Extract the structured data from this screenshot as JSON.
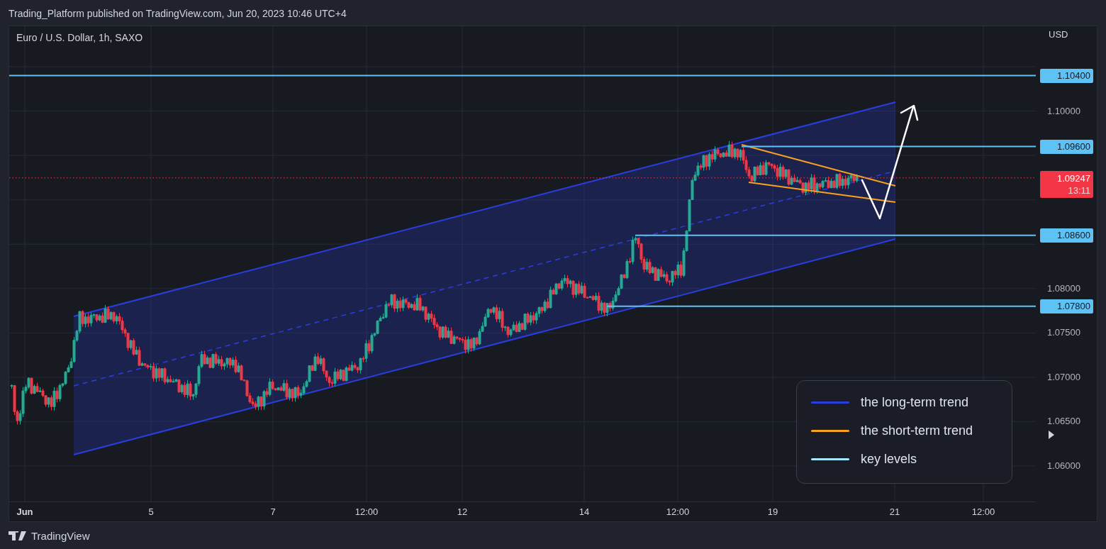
{
  "header": {
    "title": "Trading_Platform published on TradingView.com, Jun 20, 2023 10:46 UTC+4"
  },
  "chart": {
    "symbol": "Euro / U.S. Dollar, 1h, SAXO",
    "currency": "USD",
    "y_ticks": [
      "1.10000",
      "1.08000",
      "1.07500",
      "1.07000",
      "1.06500",
      "1.06000"
    ],
    "x_ticks": [
      {
        "label": "Jun",
        "kind": "month"
      },
      {
        "label": "5",
        "kind": "day"
      },
      {
        "label": "7",
        "kind": "day"
      },
      {
        "label": "12:00",
        "kind": "time"
      },
      {
        "label": "12",
        "kind": "day"
      },
      {
        "label": "14",
        "kind": "day"
      },
      {
        "label": "12:00",
        "kind": "time"
      },
      {
        "label": "19",
        "kind": "day"
      },
      {
        "label": "21",
        "kind": "day"
      },
      {
        "label": "12:00",
        "kind": "time"
      }
    ],
    "key_levels": [
      "1.10400",
      "1.09600",
      "1.08600",
      "1.07800"
    ],
    "last_price": {
      "price": "1.09247",
      "countdown": "13:11"
    },
    "legend": [
      {
        "label": "the long-term trend",
        "color": "#2a3ee0"
      },
      {
        "label": "the short-term trend",
        "color": "#f7a21b"
      },
      {
        "label": "key levels",
        "color": "#a6e6ff"
      }
    ]
  },
  "footer": {
    "brand": "TradingView"
  }
}
